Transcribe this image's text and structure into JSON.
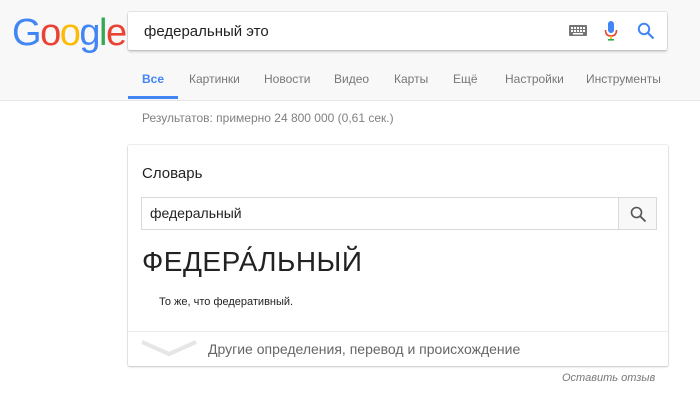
{
  "logo": {
    "letters": [
      "G",
      "o",
      "o",
      "g",
      "l",
      "e"
    ],
    "colors": [
      "#4285f4",
      "#ea4335",
      "#fbbc05",
      "#4285f4",
      "#34a853",
      "#ea4335"
    ]
  },
  "search": {
    "query": "федеральный это"
  },
  "tabs": [
    {
      "label": "Все",
      "active": true
    },
    {
      "label": "Картинки"
    },
    {
      "label": "Новости"
    },
    {
      "label": "Видео"
    },
    {
      "label": "Карты"
    },
    {
      "label": "Ещё"
    },
    {
      "label": "Настройки"
    },
    {
      "label": "Инструменты"
    }
  ],
  "results_stats": "Результатов: примерно 24 800 000 (0,61 сек.)",
  "dictionary": {
    "title": "Словарь",
    "input_value": "федеральный",
    "headword": "ФЕДЕРА́ЛЬНЫЙ",
    "definition": "То же, что федеративный.",
    "more_link": "Другие определения, перевод и происхождение"
  },
  "feedback_link": "Оставить отзыв",
  "colors": {
    "accent": "#4285f4",
    "header_bg": "#f8f8f8"
  },
  "icons": [
    "keyboard-icon",
    "microphone-icon",
    "search-icon",
    "chevron-down-icon"
  ]
}
